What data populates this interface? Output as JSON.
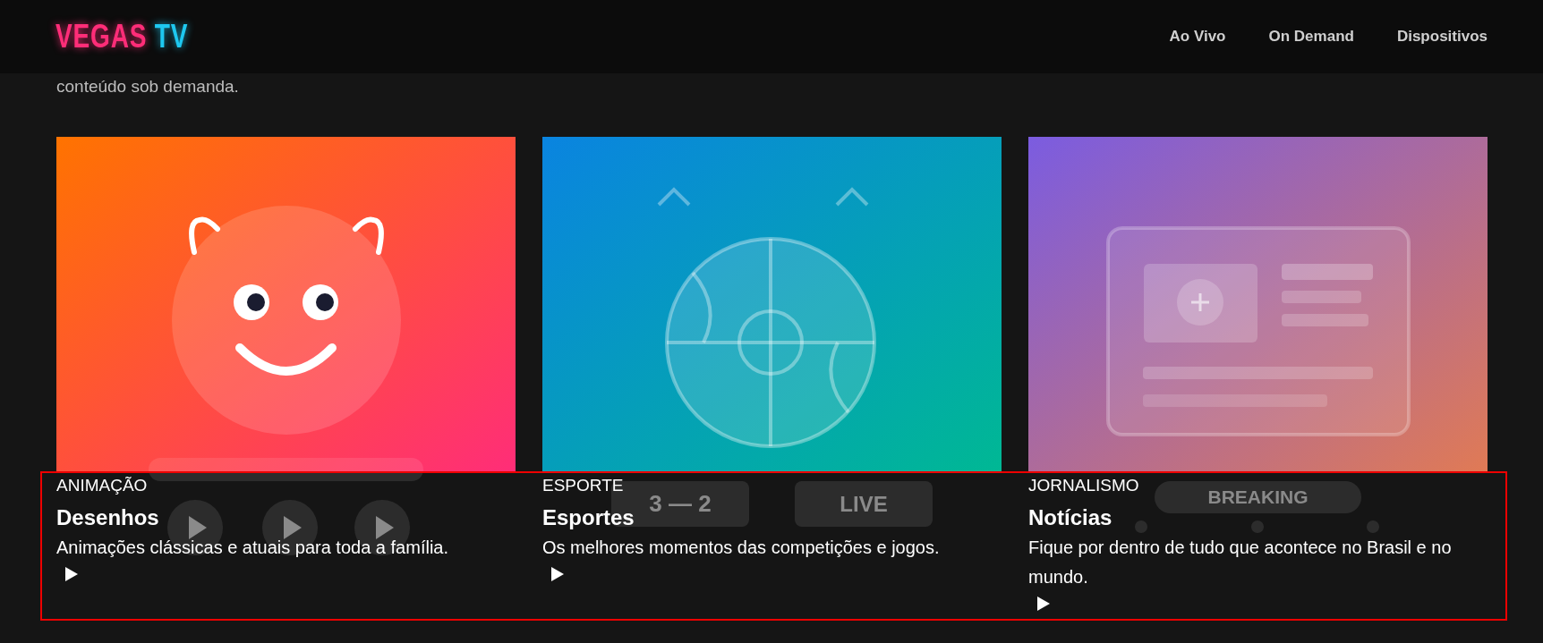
{
  "header": {
    "logo": {
      "word1": "VEGAS",
      "word2": "TV"
    },
    "nav": [
      {
        "label": "Ao Vivo"
      },
      {
        "label": "On Demand"
      },
      {
        "label": "Dispositivos"
      }
    ]
  },
  "intro": "conteúdo sob demanda.",
  "cards_section": {
    "highlighted": true,
    "cards": [
      {
        "kind": "cartoon",
        "category": "ANIMAÇÃO",
        "title": "Desenhos",
        "description": "Animações clássicas e atuais para toda a família."
      },
      {
        "kind": "sports",
        "category": "ESPORTE",
        "title": "Esportes",
        "description": "Os melhores momentos das competições e jogos.",
        "overlay_labels": [
          "3 — 2",
          "LIVE"
        ]
      },
      {
        "kind": "news",
        "category": "JORNALISMO",
        "title": "Notícias",
        "description": "Fique por dentro de tudo que acontece no Brasil e no mundo.",
        "overlay_labels": [
          "BREAKING"
        ]
      }
    ]
  }
}
